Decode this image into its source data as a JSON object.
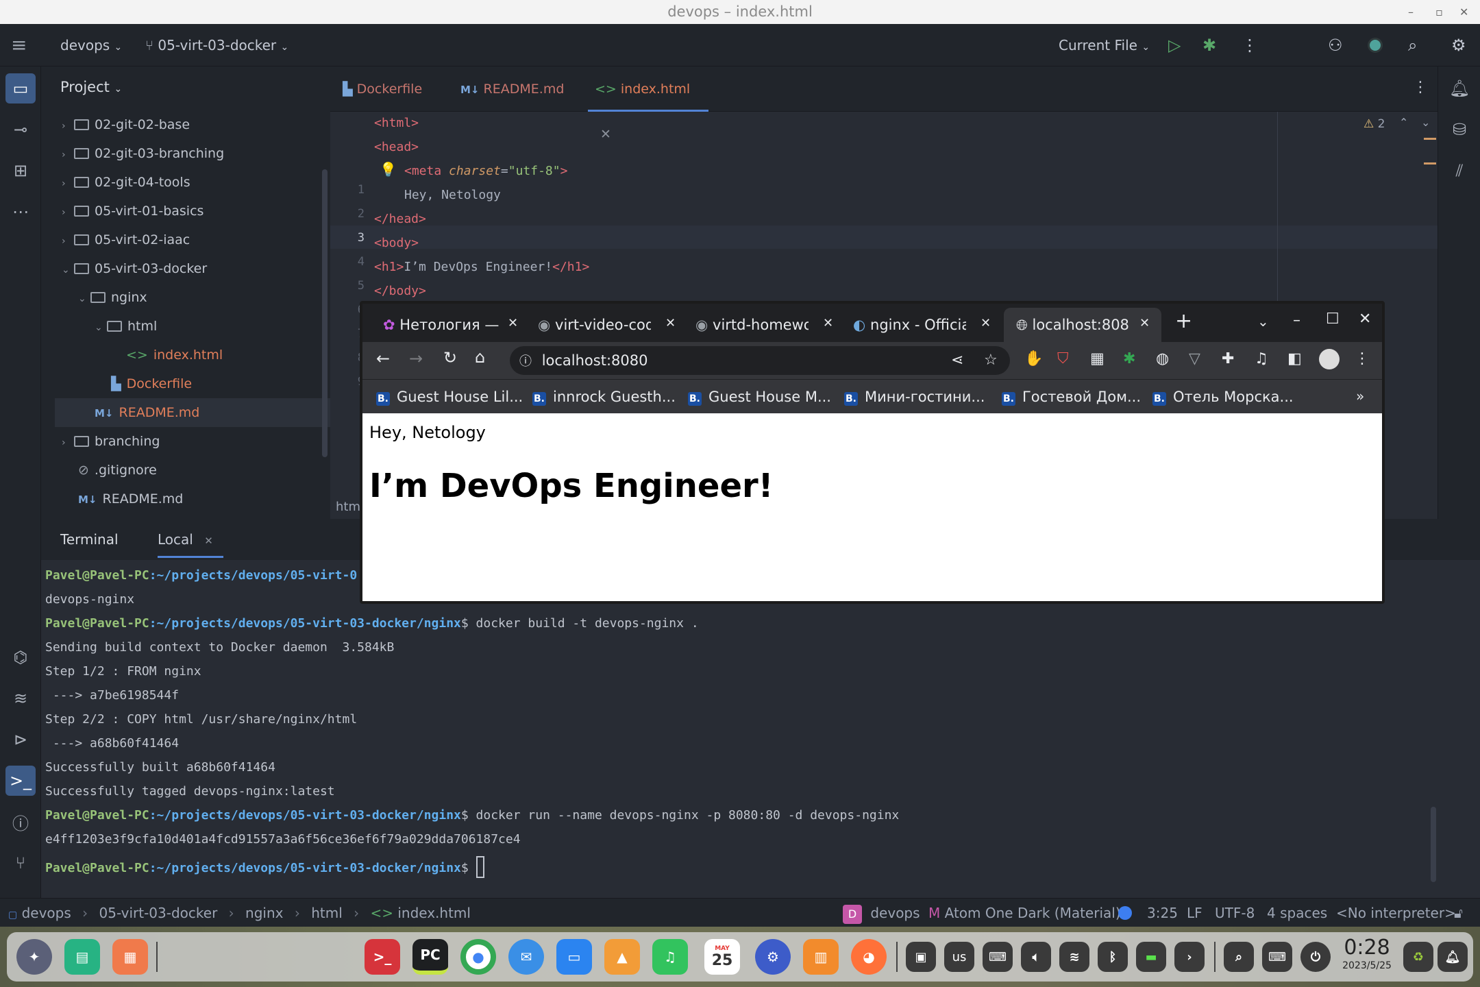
{
  "window": {
    "title": "devops – index.html"
  },
  "toolbar": {
    "project_name": "devops",
    "branch": "05-virt-03-docker",
    "run_config": "Current File"
  },
  "project_panel": {
    "title": "Project",
    "items": [
      {
        "label": "02-git-02-base"
      },
      {
        "label": "02-git-03-branching"
      },
      {
        "label": "02-git-04-tools"
      },
      {
        "label": "05-virt-01-basics"
      },
      {
        "label": "05-virt-02-iaac"
      },
      {
        "label": "05-virt-03-docker"
      },
      {
        "label": "nginx"
      },
      {
        "label": "html"
      },
      {
        "label": "index.html"
      },
      {
        "label": "Dockerfile"
      },
      {
        "label": "README.md"
      },
      {
        "label": "branching"
      },
      {
        "label": ".gitignore"
      },
      {
        "label": "README.md"
      }
    ]
  },
  "editor": {
    "tabs": [
      {
        "label": "Dockerfile"
      },
      {
        "label": "README.md"
      },
      {
        "label": "index.html"
      }
    ],
    "inspections": "2",
    "line_numbers": [
      "1",
      "2",
      "3",
      "4",
      "5",
      "6",
      "7",
      "8",
      "9"
    ],
    "lines": {
      "l1": "<html>",
      "l2": "<head>",
      "l3a": "<meta ",
      "l3b": "charset",
      "l3c": "=",
      "l3d": "\"utf-8\"",
      "l3e": ">",
      "l4": "Hey, Netology",
      "l5": "</head>",
      "l6": "<body>",
      "l7a": "<h1>",
      "l7b": "I’m DevOps Engineer!",
      "l7c": "</h1>",
      "l8": "</body>"
    },
    "breadcrumb_fragment": "htm"
  },
  "terminal": {
    "title": "Terminal",
    "tab": "Local",
    "lines": [
      {
        "prompt_user": "Pavel@Pavel-PC",
        "prompt_path": ":~/projects/devops/05-virt-0",
        "cmd": ""
      },
      {
        "text": "devops-nginx"
      },
      {
        "prompt_user": "Pavel@Pavel-PC",
        "prompt_path": ":~/projects/devops/05-virt-03-docker/nginx",
        "cmd": "$ docker build -t devops-nginx ."
      },
      {
        "text": "Sending build context to Docker daemon  3.584kB"
      },
      {
        "text": "Step 1/2 : FROM nginx"
      },
      {
        "text": " ---> a7be6198544f"
      },
      {
        "text": "Step 2/2 : COPY html /usr/share/nginx/html"
      },
      {
        "text": " ---> a68b60f41464"
      },
      {
        "text": "Successfully built a68b60f41464"
      },
      {
        "text": "Successfully tagged devops-nginx:latest"
      },
      {
        "prompt_user": "Pavel@Pavel-PC",
        "prompt_path": ":~/projects/devops/05-virt-03-docker/nginx",
        "cmd": "$ docker run --name devops-nginx -p 8080:80 -d devops-nginx"
      },
      {
        "text": "e4ff1203e3f9cfa10d401a4fcd91557a3a6f56ce36ef6f79a029dda706187ce4"
      },
      {
        "prompt_user": "Pavel@Pavel-PC",
        "prompt_path": ":~/projects/devops/05-virt-03-docker/nginx",
        "cmd": "$ "
      }
    ]
  },
  "statusbar": {
    "crumbs": [
      "devops",
      "05-virt-03-docker",
      "nginx",
      "html",
      "index.html"
    ],
    "vcs_badge": "D",
    "vcs_project": "devops",
    "theme": "Atom One Dark (Material)",
    "position": "3:25",
    "line_sep": "LF",
    "encoding": "UTF-8",
    "indent": "4 spaces",
    "interpreter": "<No interpreter>"
  },
  "browser": {
    "tabs": [
      {
        "label": "Нетология — "
      },
      {
        "label": "virt-video-cod"
      },
      {
        "label": "virtd-homewo"
      },
      {
        "label": "nginx - Officia"
      },
      {
        "label": "localhost:808"
      }
    ],
    "url": "localhost:8080",
    "bookmarks": [
      {
        "label": "Guest House Lil..."
      },
      {
        "label": "innrock Guesth..."
      },
      {
        "label": "Guest House M..."
      },
      {
        "label": "Мини-гостини..."
      },
      {
        "label": "Гостевой Дом..."
      },
      {
        "label": "Отель Морска..."
      }
    ],
    "bookmark_badge": "B.",
    "page_text": "Hey, Netology",
    "page_heading": "I’m DevOps Engineer!"
  },
  "taskbar": {
    "calendar_day": "25",
    "calendar_month": "MAY",
    "keyboard_layout": "us",
    "time": "0:28",
    "date": "2023/5/25"
  },
  "colors": {
    "ide_bg": "#282c34",
    "ide_panel": "#21252b",
    "accent": "#5283d5",
    "prompt_green": "#98c379",
    "prompt_blue": "#61afef"
  }
}
